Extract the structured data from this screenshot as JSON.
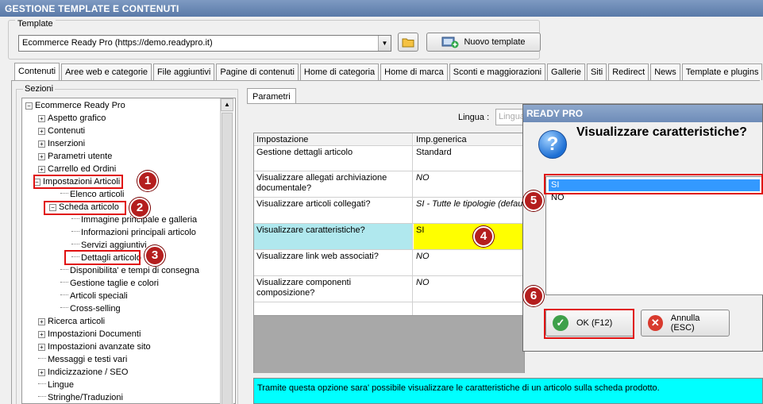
{
  "window": {
    "title": "GESTIONE TEMPLATE E CONTENUTI"
  },
  "template": {
    "label": "Template",
    "selected": "Ecommerce Ready Pro (https://demo.readypro.it)",
    "new_button": "Nuovo template",
    "folder_icon": "folder-icon",
    "add_icon": "add-template-icon"
  },
  "tabs": [
    "Contenuti",
    "Aree web e categorie",
    "File aggiuntivi",
    "Pagine di contenuti",
    "Home di categoria",
    "Home di marca",
    "Sconti e maggiorazioni",
    "Gallerie",
    "Siti",
    "Redirect",
    "News",
    "Template e plugins"
  ],
  "sezioni": {
    "label": "Sezioni",
    "items": [
      {
        "label": "Ecommerce Ready Pro",
        "exp": "⊟"
      },
      {
        "label": "Aspetto grafico",
        "exp": "⊞"
      },
      {
        "label": "Contenuti",
        "exp": "⊞"
      },
      {
        "label": "Inserzioni",
        "exp": "⊞"
      },
      {
        "label": "Parametri utente",
        "exp": "⊞"
      },
      {
        "label": "Carrello ed Ordini",
        "exp": "⊞"
      },
      {
        "label": "Impostazioni Articoli",
        "exp": "⊟"
      },
      {
        "label": "Elenco articoli",
        "exp": ""
      },
      {
        "label": "Scheda articolo",
        "exp": "⊟"
      },
      {
        "label": "Immagine principale e galleria",
        "exp": ""
      },
      {
        "label": "Informazioni principali articolo",
        "exp": ""
      },
      {
        "label": "Servizi aggiuntivi",
        "exp": ""
      },
      {
        "label": "Dettagli articolo",
        "exp": ""
      },
      {
        "label": "Disponibilita' e tempi di consegna",
        "exp": ""
      },
      {
        "label": "Gestione taglie e colori",
        "exp": ""
      },
      {
        "label": "Articoli speciali",
        "exp": ""
      },
      {
        "label": "Cross-selling",
        "exp": ""
      },
      {
        "label": "Ricerca articoli",
        "exp": "⊞"
      },
      {
        "label": "Impostazioni Documenti",
        "exp": "⊞"
      },
      {
        "label": "Impostazioni avanzate sito",
        "exp": "⊞"
      },
      {
        "label": "Messaggi e testi vari",
        "exp": ""
      },
      {
        "label": "Indicizzazione / SEO",
        "exp": "⊞"
      },
      {
        "label": "Lingue",
        "exp": ""
      },
      {
        "label": "Stringhe/Traduzioni",
        "exp": ""
      }
    ]
  },
  "parametri": {
    "tab_label": "Parametri",
    "lingua_label": "Lingua :",
    "lingua_value": "Lingua",
    "headers": [
      "Impostazione",
      "Imp.generica"
    ],
    "rows": [
      {
        "setting": "Gestione dettagli articolo",
        "value": "Standard"
      },
      {
        "setting": "Visualizzare allegati archiviazione documentale?",
        "value": "NO"
      },
      {
        "setting": "Visualizzare articoli collegati?",
        "value": "SI - Tutte le tipologie (default)"
      },
      {
        "setting": "Visualizzare caratteristiche?",
        "value": "SI"
      },
      {
        "setting": "Visualizzare link web associati?",
        "value": "NO"
      },
      {
        "setting": "Visualizzare componenti composizione?",
        "value": "NO"
      }
    ],
    "description": "Tramite questa opzione sara' possibile visualizzare le caratteristiche di un articolo sulla scheda prodotto."
  },
  "dialog": {
    "title": "READY PRO",
    "question": "Visualizzare caratteristiche?",
    "options": [
      "SI",
      "NO"
    ],
    "selected_option": "SI",
    "ok_label": "OK (F12)",
    "cancel_label": "Annulla (ESC)"
  },
  "callouts": [
    "1",
    "2",
    "3",
    "4",
    "5",
    "6"
  ],
  "colors": {
    "highlight_row": "#b0e8ee",
    "highlight_value": "#ffff00",
    "description_bg": "#00ffff",
    "callout_red": "#b41e1e",
    "selection_blue": "#3399ff"
  }
}
